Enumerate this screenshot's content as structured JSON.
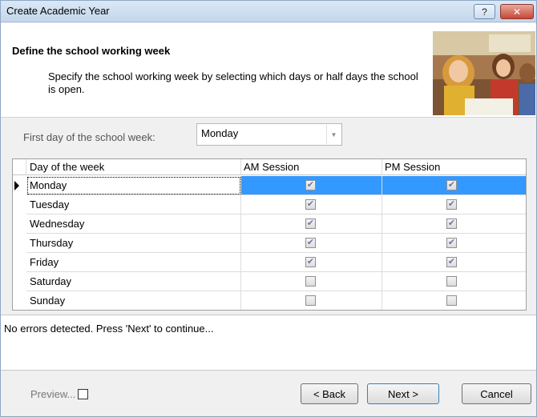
{
  "window": {
    "title": "Create Academic Year",
    "help_label": "?",
    "close_label": "✕"
  },
  "header": {
    "title": "Define the school working week",
    "description": "Specify the school working week by selecting which days or half days the school is open."
  },
  "first_day": {
    "label": "First day of the school week:",
    "value": "Monday"
  },
  "grid": {
    "columns": [
      "Day of the week",
      "AM Session",
      "PM Session"
    ],
    "rows": [
      {
        "day": "Monday",
        "am": true,
        "pm": true,
        "selected": true
      },
      {
        "day": "Tuesday",
        "am": true,
        "pm": true
      },
      {
        "day": "Wednesday",
        "am": true,
        "pm": true
      },
      {
        "day": "Thursday",
        "am": true,
        "pm": true
      },
      {
        "day": "Friday",
        "am": true,
        "pm": true
      },
      {
        "day": "Saturday",
        "am": false,
        "pm": false
      },
      {
        "day": "Sunday",
        "am": false,
        "pm": false
      }
    ]
  },
  "messages": {
    "text": "No errors detected. Press 'Next' to continue..."
  },
  "footer": {
    "preview_label": "Preview...",
    "back_label": "< Back",
    "next_label": "Next >",
    "cancel_label": "Cancel"
  },
  "colors": {
    "selection": "#3399ff",
    "title_bar": "#c4d7ec",
    "close_button": "#c8463a"
  }
}
